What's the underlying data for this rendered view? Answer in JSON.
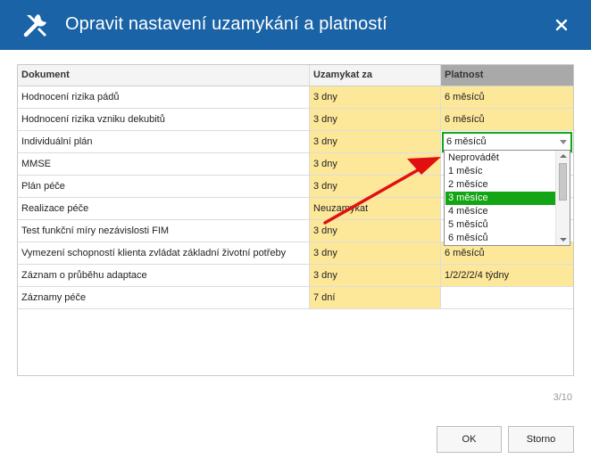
{
  "dialog": {
    "title": "Opravit nastavení uzamykání a platností",
    "title_icon": "tools-icon",
    "close_icon": "close-icon",
    "accent_color": "#1a63a6"
  },
  "table": {
    "headers": [
      "Dokument",
      "Uzamykat za",
      "Platnost"
    ],
    "rows": [
      {
        "dokument": "Hodnocení rizika pádů",
        "uzamykat": "3 dny",
        "platnost": "6 měsíců"
      },
      {
        "dokument": "Hodnocení rizika vzniku dekubitů",
        "uzamykat": "3 dny",
        "platnost": "6 měsíců"
      },
      {
        "dokument": "Individuální plán",
        "uzamykat": "3 dny",
        "platnost": "6 měsíců"
      },
      {
        "dokument": "MMSE",
        "uzamykat": "3 dny",
        "platnost": ""
      },
      {
        "dokument": "Plán péče",
        "uzamykat": "3 dny",
        "platnost": ""
      },
      {
        "dokument": "Realizace péče",
        "uzamykat": "Neuzamykat",
        "platnost": ""
      },
      {
        "dokument": "Test funkční míry nezávislosti FIM",
        "uzamykat": "3 dny",
        "platnost": ""
      },
      {
        "dokument": "Vymezení schopností klienta zvládat základní životní potřeby",
        "uzamykat": "3 dny",
        "platnost": "6 měsíců"
      },
      {
        "dokument": "Záznam o průběhu adaptace",
        "uzamykat": "3 dny",
        "platnost": "1/2/2/2/4 týdny"
      },
      {
        "dokument": "Záznamy péče",
        "uzamykat": "7 dní",
        "platnost": ""
      }
    ]
  },
  "editor": {
    "current_value": "6 měsíců",
    "options": [
      "Neprovádět",
      "1 měsíc",
      "2 měsíce",
      "3 měsíce",
      "4 měsíce",
      "5 měsíců",
      "6 měsíců"
    ],
    "highlighted": "3 měsíce"
  },
  "pager": "3/10",
  "buttons": {
    "ok": "OK",
    "cancel": "Storno"
  }
}
